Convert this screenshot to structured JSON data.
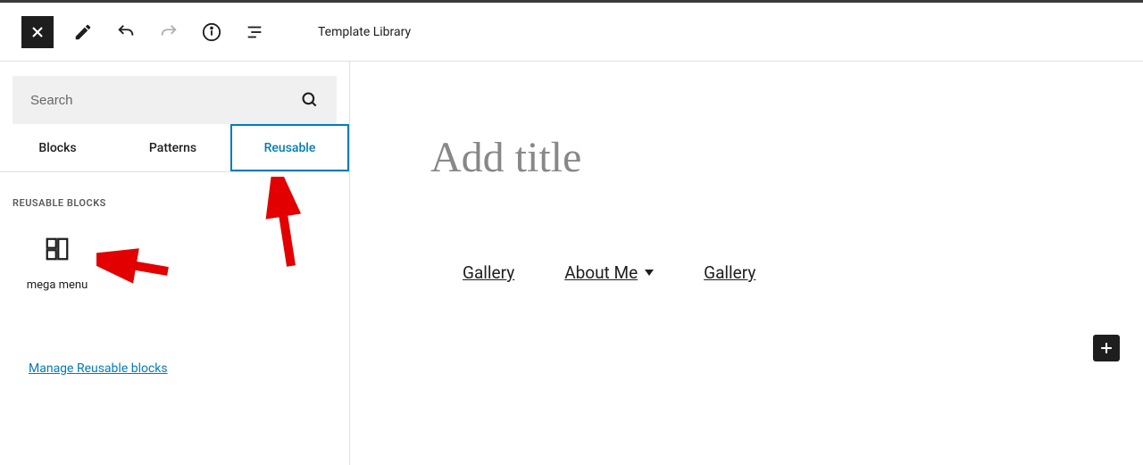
{
  "toolbar": {
    "template_library_label": "Template Library"
  },
  "sidebar": {
    "search_placeholder": "Search",
    "tabs": {
      "blocks": "Blocks",
      "patterns": "Patterns",
      "reusable": "Reusable"
    },
    "section_heading": "REUSABLE BLOCKS",
    "block_item_label": "mega menu",
    "manage_link": "Manage Reusable blocks"
  },
  "canvas": {
    "title_placeholder": "Add title",
    "nav": {
      "item1": "Gallery",
      "item2": "About Me",
      "item3": "Gallery"
    }
  }
}
